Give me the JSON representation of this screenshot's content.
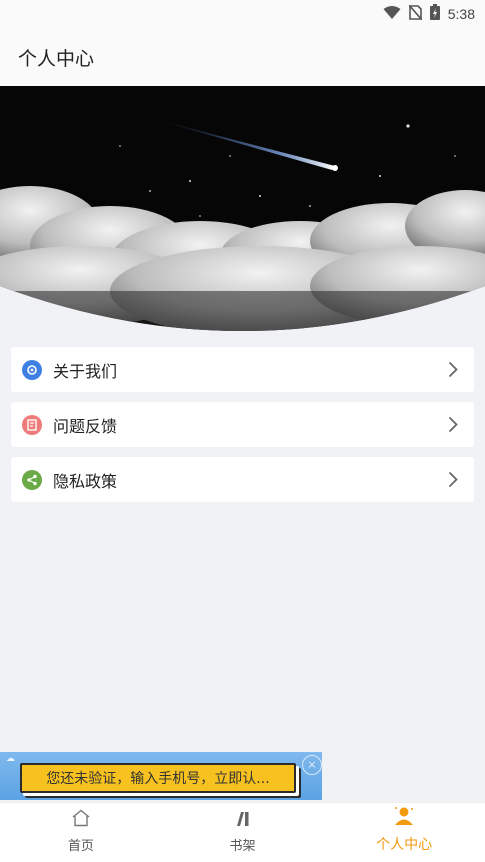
{
  "status": {
    "time": "5:38"
  },
  "header": {
    "title": "个人中心"
  },
  "menu": {
    "items": [
      {
        "label": "关于我们",
        "icon": "gear-icon",
        "color": "#3d7fe3"
      },
      {
        "label": "问题反馈",
        "icon": "feedback-icon",
        "color": "#ef7a7a"
      },
      {
        "label": "隐私政策",
        "icon": "share-icon",
        "color": "#6aaa45"
      }
    ]
  },
  "ad": {
    "text": "您还未验证，输入手机号，立即认...",
    "close": "×"
  },
  "tabs": [
    {
      "label": "首页",
      "icon": "home-icon",
      "active": false
    },
    {
      "label": "书架",
      "icon": "bookshelf-icon",
      "active": false
    },
    {
      "label": "个人中心",
      "icon": "person-icon",
      "active": true
    }
  ],
  "colors": {
    "accent": "#f29a10",
    "background": "#f1f2f6"
  }
}
